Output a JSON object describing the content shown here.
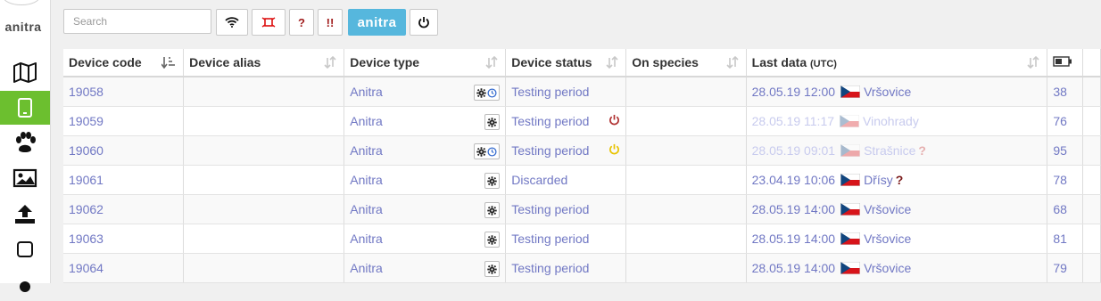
{
  "app": {
    "brand": "anitra"
  },
  "sidebar": {
    "items": [
      {
        "icon": "map-icon",
        "active": false
      },
      {
        "icon": "tablet-icon",
        "active": true
      },
      {
        "icon": "paw-icon",
        "active": false
      },
      {
        "icon": "image-icon",
        "active": false
      },
      {
        "icon": "upload-icon",
        "active": false
      },
      {
        "icon": "square-icon",
        "active": false
      },
      {
        "icon": "user-icon",
        "active": false
      }
    ]
  },
  "toolbar": {
    "search_placeholder": "Search",
    "help_label": "?",
    "alert_label": "!!",
    "anitra_label": "anitra"
  },
  "columns": {
    "device_code": "Device code",
    "device_alias": "Device alias",
    "device_type": "Device type",
    "device_status": "Device status",
    "on_species": "On species",
    "last_data": "Last data",
    "last_data_unit": "(UTC)"
  },
  "rows": [
    {
      "code": "19058",
      "alias": "",
      "type": "Anitra",
      "status": "Testing period",
      "species": "",
      "last_data": "28.05.19 12:00",
      "location": "Vršovice",
      "battery": "38",
      "config": "gear-clock",
      "power": "",
      "faded": false,
      "unknown": ""
    },
    {
      "code": "19059",
      "alias": "",
      "type": "Anitra",
      "status": "Testing period",
      "species": "",
      "last_data": "28.05.19 11:17",
      "location": "Vinohrady",
      "battery": "76",
      "config": "gear",
      "power": "off",
      "faded": true,
      "unknown": ""
    },
    {
      "code": "19060",
      "alias": "",
      "type": "Anitra",
      "status": "Testing period",
      "species": "",
      "last_data": "28.05.19 09:01",
      "location": "Strašnice",
      "battery": "95",
      "config": "gear-clock",
      "power": "on",
      "faded": true,
      "unknown": "?"
    },
    {
      "code": "19061",
      "alias": "",
      "type": "Anitra",
      "status": "Discarded",
      "species": "",
      "last_data": "23.04.19 10:06",
      "location": "Dřísy",
      "battery": "78",
      "config": "gear",
      "power": "",
      "faded": false,
      "unknown": "?"
    },
    {
      "code": "19062",
      "alias": "",
      "type": "Anitra",
      "status": "Testing period",
      "species": "",
      "last_data": "28.05.19 14:00",
      "location": "Vršovice",
      "battery": "68",
      "config": "gear",
      "power": "",
      "faded": false,
      "unknown": ""
    },
    {
      "code": "19063",
      "alias": "",
      "type": "Anitra",
      "status": "Testing period",
      "species": "",
      "last_data": "28.05.19 14:00",
      "location": "Vršovice",
      "battery": "81",
      "config": "gear",
      "power": "",
      "faded": false,
      "unknown": ""
    },
    {
      "code": "19064",
      "alias": "",
      "type": "Anitra",
      "status": "Testing period",
      "species": "",
      "last_data": "28.05.19 14:00",
      "location": "Vršovice",
      "battery": "79",
      "config": "gear",
      "power": "",
      "faded": false,
      "unknown": ""
    }
  ],
  "colors": {
    "accent": "#6cbf2f",
    "brand_button": "#56b7dd",
    "link": "#7178c4",
    "power_off": "#b03030",
    "power_on": "#e8c300",
    "unknown": "#7a1a1a"
  }
}
